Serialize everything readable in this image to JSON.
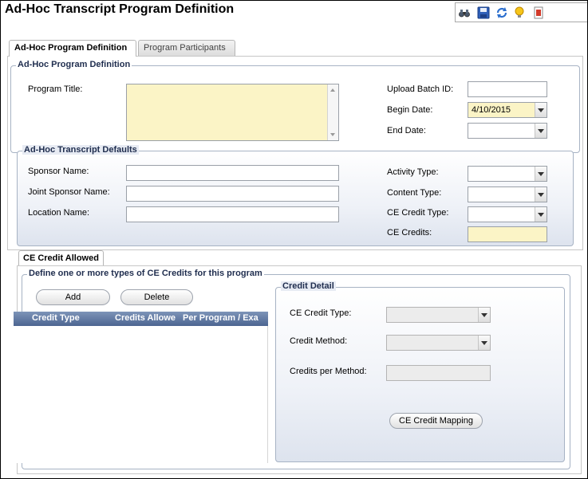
{
  "window": {
    "title": "Ad-Hoc Transcript Program Definition"
  },
  "toolbar": {
    "icons": [
      "binoculars-icon",
      "save-icon",
      "refresh-icon",
      "lightbulb-icon",
      "report-icon"
    ]
  },
  "tabs": [
    {
      "label": "Ad-Hoc Program Definition",
      "active": true
    },
    {
      "label": "Program Participants",
      "active": false
    }
  ],
  "program_definition": {
    "legend": "Ad-Hoc Program Definition",
    "program_title_label": "Program Title:",
    "program_title_value": "",
    "upload_batch_id_label": "Upload Batch ID:",
    "upload_batch_id_value": "",
    "begin_date_label": "Begin Date:",
    "begin_date_value": "4/10/2015",
    "end_date_label": "End Date:",
    "end_date_value": ""
  },
  "transcript_defaults": {
    "legend": "Ad-Hoc Transcript Defaults",
    "sponsor_name_label": "Sponsor Name:",
    "sponsor_name_value": "",
    "joint_sponsor_name_label": "Joint Sponsor Name:",
    "joint_sponsor_name_value": "",
    "location_name_label": "Location Name:",
    "location_name_value": "",
    "activity_type_label": "Activity Type:",
    "activity_type_value": "",
    "content_type_label": "Content Type:",
    "content_type_value": "",
    "ce_credit_type_label": "CE Credit Type:",
    "ce_credit_type_value": "",
    "ce_credits_label": "CE Credits:",
    "ce_credits_value": ""
  },
  "ce_credit_allowed": {
    "tab_label": "CE Credit Allowed",
    "legend": "Define one or more types of CE Credits for this program",
    "add_label": "Add",
    "delete_label": "Delete",
    "grid_columns": [
      "Credit Type",
      "Credits Allowe",
      "Per Program / Exa"
    ],
    "grid_rows": []
  },
  "credit_detail": {
    "legend": "Credit Detail",
    "ce_credit_type_label": "CE Credit Type:",
    "ce_credit_type_value": "",
    "credit_method_label": "Credit Method:",
    "credit_method_value": "",
    "credits_per_method_label": "Credits per Method:",
    "credits_per_method_value": "",
    "mapping_button_label": "CE Credit Mapping"
  }
}
